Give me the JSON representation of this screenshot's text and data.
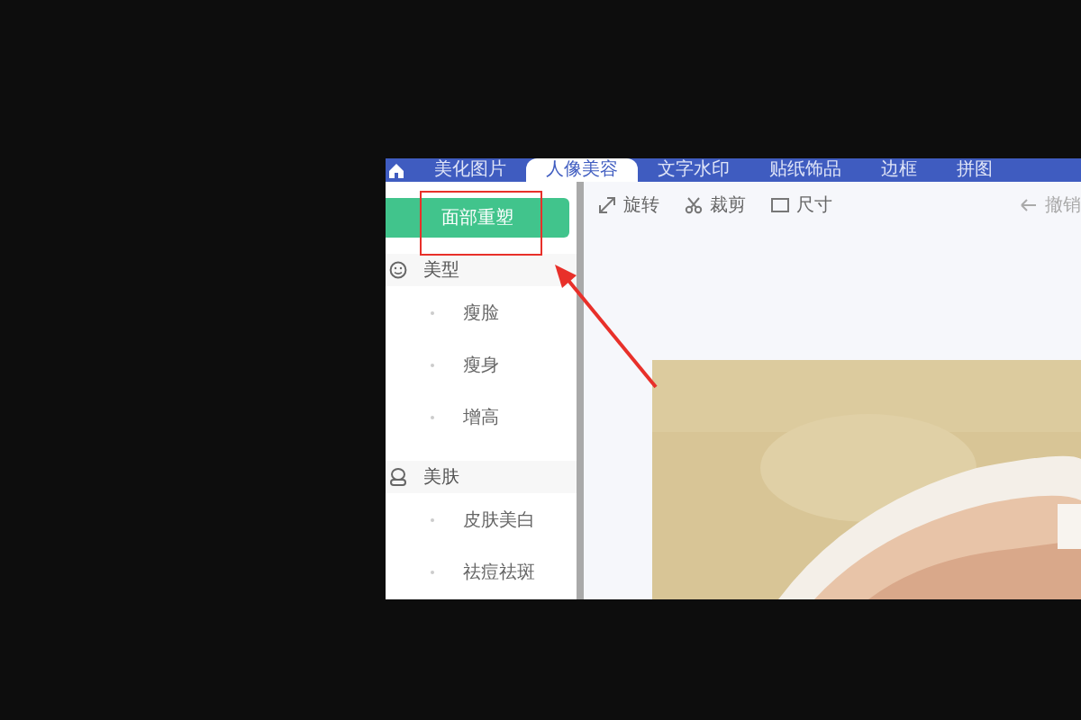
{
  "tabs": [
    {
      "label": "美化图片",
      "selected": false
    },
    {
      "label": "人像美容",
      "selected": true
    },
    {
      "label": "文字水印",
      "selected": false
    },
    {
      "label": "贴纸饰品",
      "selected": false
    },
    {
      "label": "边框",
      "selected": false
    },
    {
      "label": "拼图",
      "selected": false
    }
  ],
  "sidebar": {
    "button": "面部重塑",
    "sections": [
      {
        "title": "美型",
        "kind": "face",
        "items": [
          "瘦脸",
          "瘦身",
          "增高"
        ]
      },
      {
        "title": "美肤",
        "kind": "skin",
        "items": [
          "皮肤美白",
          "祛痘祛斑"
        ]
      }
    ]
  },
  "toolbar": [
    {
      "label": "旋转",
      "kind": "rotate"
    },
    {
      "label": "裁剪",
      "kind": "crop"
    },
    {
      "label": "尺寸",
      "kind": "size"
    }
  ],
  "undo": "撤销",
  "annotations": {
    "highlight_box": true,
    "arrow": true
  }
}
